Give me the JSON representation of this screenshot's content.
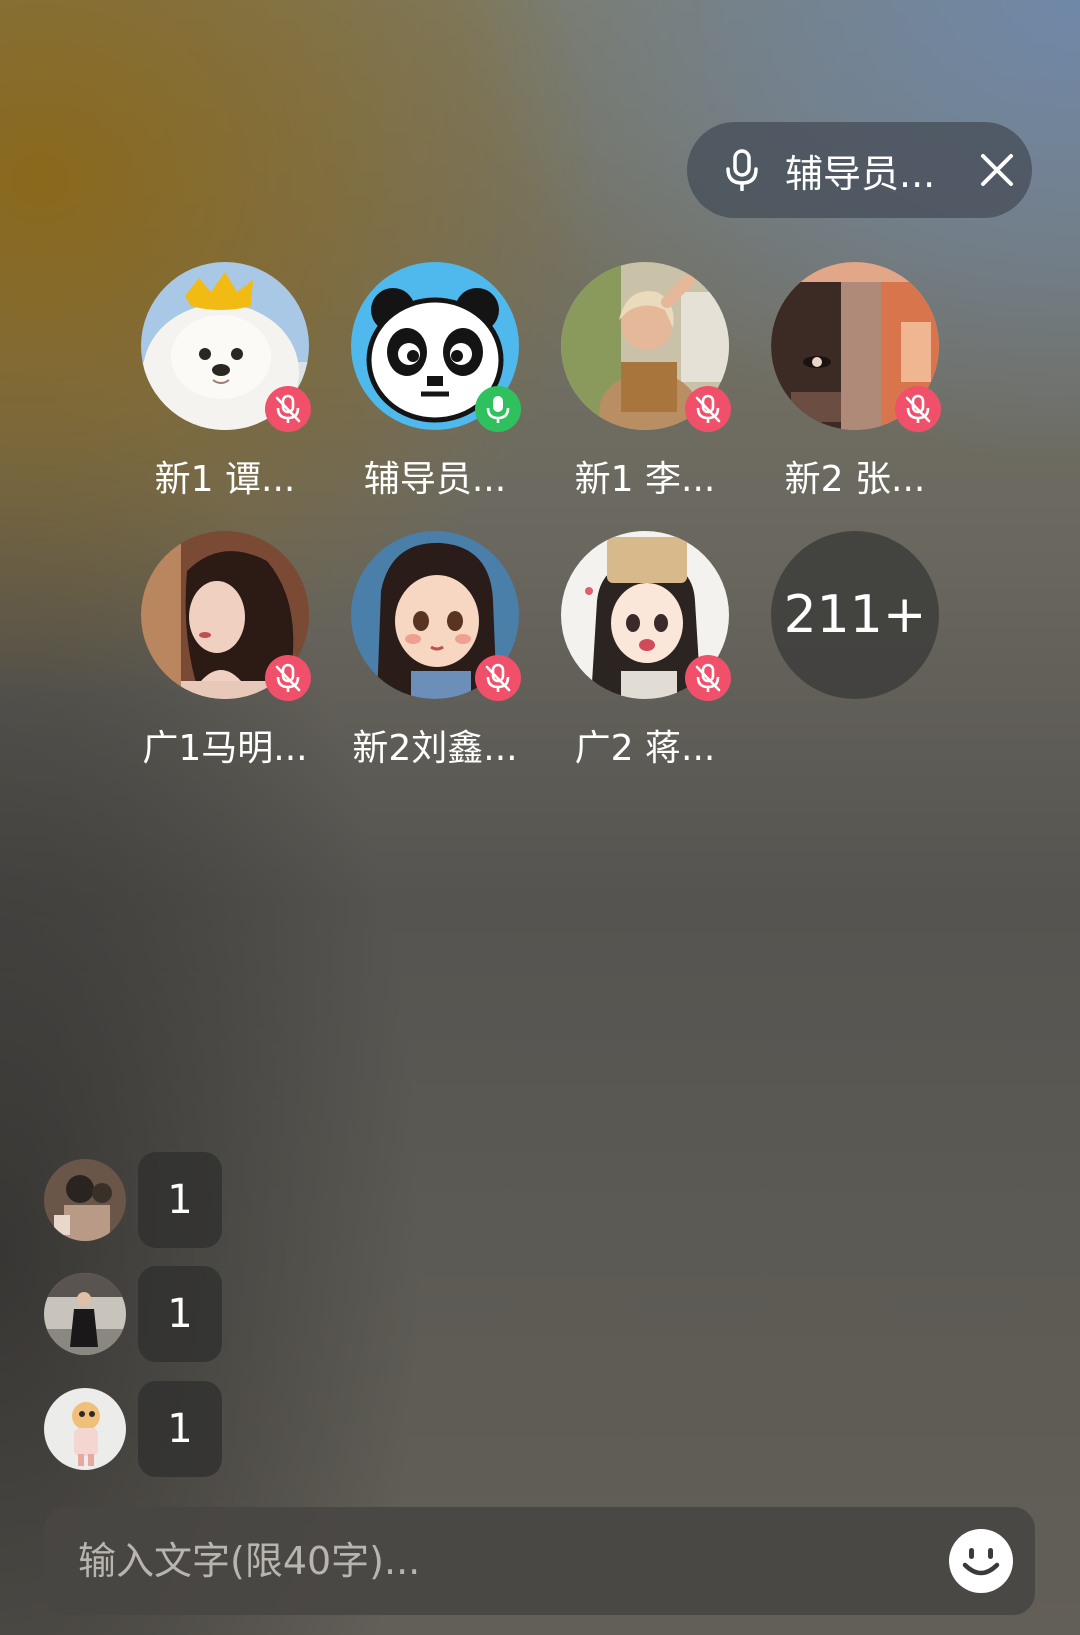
{
  "voice_pill": {
    "label": "辅导员...",
    "mic_icon": "mic-icon",
    "close_icon": "close-icon"
  },
  "members": [
    {
      "name": "新1 谭...",
      "status": "muted",
      "avatar": "pomeranian-dog-avatar"
    },
    {
      "name": "辅导员...",
      "status": "speaking",
      "avatar": "pixel-panda-avatar"
    },
    {
      "name": "新1 李...",
      "status": "muted",
      "avatar": "woman-photo-avatar"
    },
    {
      "name": "新2 张...",
      "status": "muted",
      "avatar": "collage-photo-avatar"
    },
    {
      "name": "广1马明...",
      "status": "muted",
      "avatar": "woman-portrait-avatar"
    },
    {
      "name": "新2刘鑫...",
      "status": "muted",
      "avatar": "cartoon-girl-avatar"
    },
    {
      "name": "广2  蒋...",
      "status": "muted",
      "avatar": "cartoon-girl-hat-avatar"
    }
  ],
  "more_count": "211+",
  "messages": [
    {
      "text": "1",
      "avatar": "user-photo-avatar"
    },
    {
      "text": "1",
      "avatar": "user-photo-avatar"
    },
    {
      "text": "1",
      "avatar": "user-photo-avatar"
    }
  ],
  "input": {
    "placeholder": "输入文字(限40字)...",
    "value": "",
    "emoji_icon": "smiley-icon"
  },
  "colors": {
    "muted_badge": "#f0506a",
    "active_badge": "#2fc15d"
  }
}
